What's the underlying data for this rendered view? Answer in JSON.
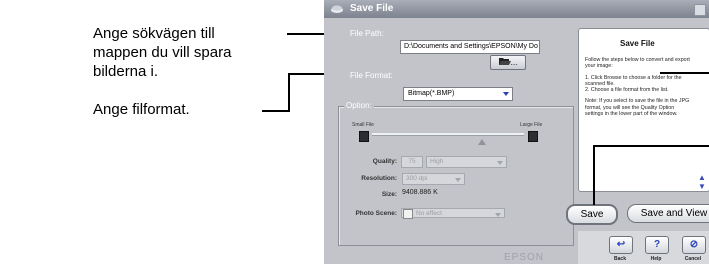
{
  "annotations": {
    "file_path_lines": [
      "Ange sökvägen till",
      "mappen du vill spara",
      "bilderna i."
    ],
    "file_format": "Ange filformat."
  },
  "dialog": {
    "title": "Save File",
    "file_path_label": "File Path:",
    "file_path_value": "D:\\Documents and Settings\\EPSON\\My Do",
    "browse_label": "...",
    "file_format_label": "File Format:",
    "file_format_value": "Bitmap(*.BMP)",
    "option_title": "Option:",
    "small_file_label": "Small File",
    "large_file_label": "Large File",
    "quality_label": "Quality:",
    "quality_value": "75",
    "quality_level": "High",
    "resolution_label": "Resolution:",
    "resolution_value": "300 dpi",
    "size_label": "Size:",
    "size_value": "9408.886 K",
    "photo_scene_label": "Photo Scene:",
    "photo_scene_value": "No effect",
    "brand": "EPSON"
  },
  "help": {
    "title": "Save File",
    "paragraphs": [
      "Follow the steps below to convert and export your image:",
      "1. Click Browse to choose a folder for the scanned file.\n2. Choose a file format from the list.",
      "Note: If you select to save the file in the JPG format, you will see the Quality Option settings in the lower part of the window."
    ]
  },
  "buttons": {
    "save": "Save",
    "save_and_view": "Save and View",
    "back": "Back",
    "help": "Help",
    "cancel": "Cancel"
  },
  "icons": {
    "title": "scanner-icon",
    "browse": "folder-open-icon",
    "back": "back-arrow-icon",
    "help": "question-icon",
    "cancel": "cancel-icon"
  },
  "colors": {
    "dialog_bg": "#c2c4ca",
    "accent_blue": "#2942b8"
  }
}
